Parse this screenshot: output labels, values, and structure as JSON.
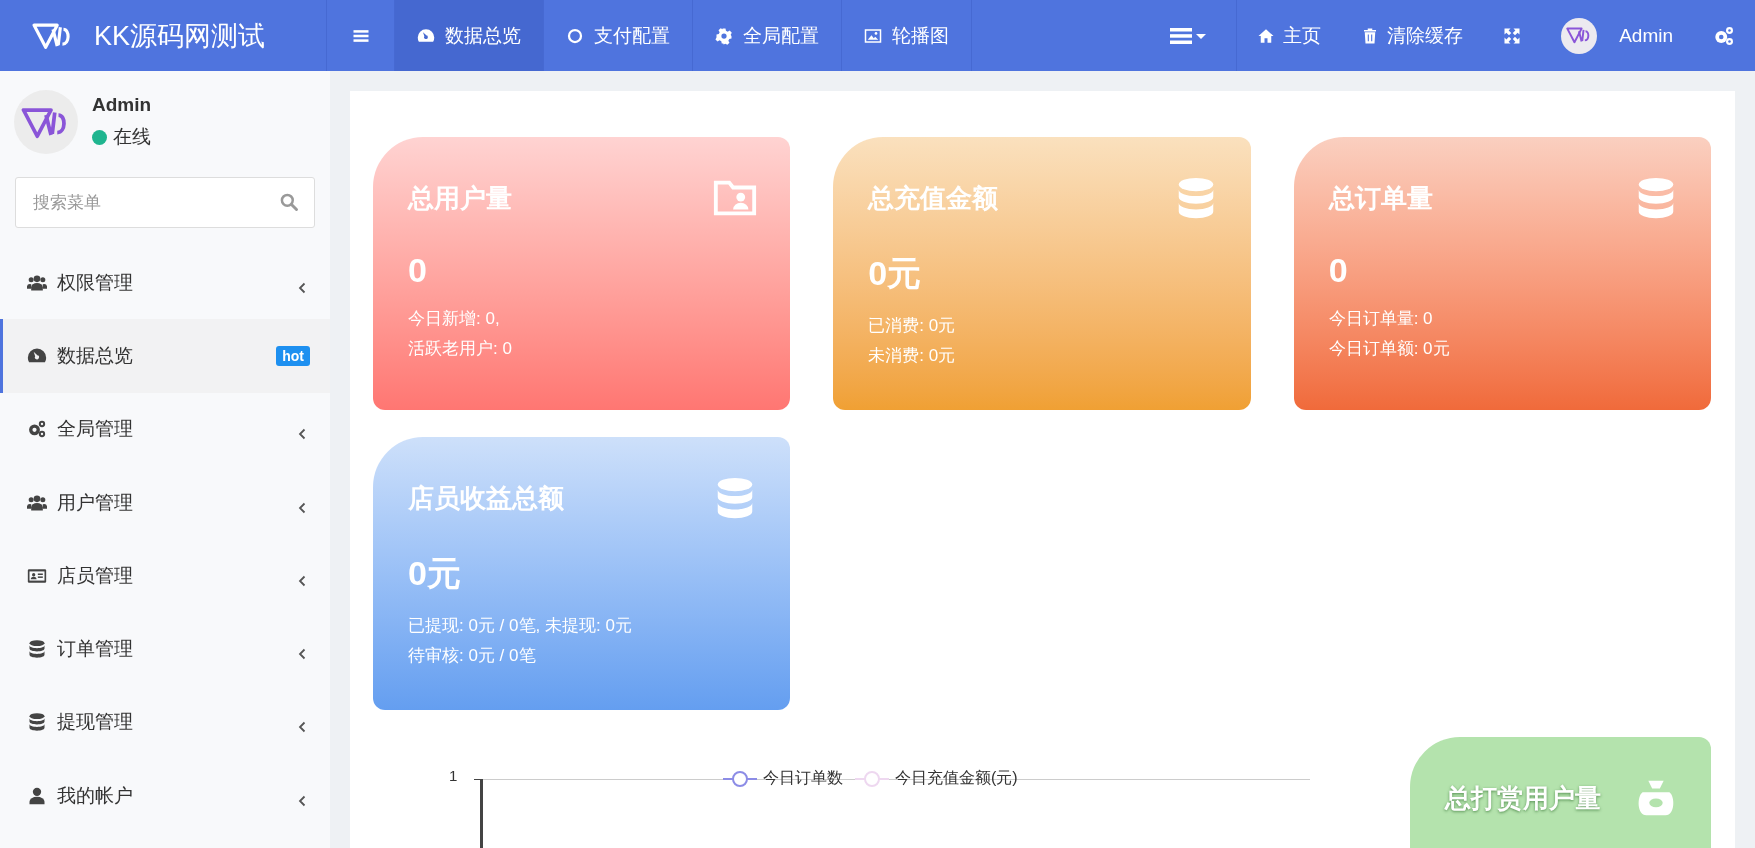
{
  "brand": {
    "title": "KK源码网测试"
  },
  "top_nav": [
    {
      "kind": "dashboard",
      "label": "数据总览",
      "selected": true
    },
    {
      "kind": "circle",
      "label": "支付配置",
      "selected": false
    },
    {
      "kind": "cog",
      "label": "全局配置",
      "selected": false
    },
    {
      "kind": "image",
      "label": "轮播图",
      "selected": false
    }
  ],
  "top_right": [
    {
      "kind": "list-dropdown"
    },
    {
      "kind": "home",
      "label": "主页"
    },
    {
      "kind": "trash",
      "label": "清除缓存"
    },
    {
      "kind": "expand"
    },
    {
      "kind": "avatar",
      "label": "Admin"
    },
    {
      "kind": "cogs"
    }
  ],
  "sidebar": {
    "user": {
      "name": "Admin",
      "status": "在线",
      "online": true
    },
    "search": {
      "placeholder": "搜索菜单"
    },
    "items": [
      {
        "kind": "users",
        "label": "权限管理",
        "selected": false,
        "expandable": true
      },
      {
        "kind": "dashboard",
        "label": "数据总览",
        "selected": true,
        "expandable": false,
        "badge": "hot"
      },
      {
        "kind": "cogs",
        "label": "全局管理",
        "selected": false,
        "expandable": true
      },
      {
        "kind": "users",
        "label": "用户管理",
        "selected": false,
        "expandable": true
      },
      {
        "kind": "idcard",
        "label": "店员管理",
        "selected": false,
        "expandable": true
      },
      {
        "kind": "database",
        "label": "订单管理",
        "selected": false,
        "expandable": true
      },
      {
        "kind": "database",
        "label": "提现管理",
        "selected": false,
        "expandable": true
      },
      {
        "kind": "user",
        "label": "我的帐户",
        "selected": false,
        "expandable": true
      }
    ]
  },
  "cards": [
    {
      "title": "总用户量",
      "kind": "folder-user",
      "value": "0",
      "lines": [
        "今日新增: 0,",
        "活跃老用户: 0"
      ],
      "color": "#ff7672"
    },
    {
      "title": "总充值金额",
      "kind": "database",
      "value": "0元",
      "lines": [
        "已消费: 0元",
        "未消费: 0元"
      ],
      "color": "#f0a033"
    },
    {
      "title": "总订单量",
      "kind": "database",
      "value": "0",
      "lines": [
        "今日订单量: 0",
        "今日订单额: 0元"
      ],
      "color": "#f06a3a"
    },
    {
      "title": "店员收益总额",
      "kind": "database",
      "value": "0元",
      "lines": [
        "已提现: 0元 / 0笔, 未提现: 0元",
        "待审核: 0元 / 0笔"
      ],
      "color": "#649ef0"
    }
  ],
  "chart": {
    "y_tick": "1",
    "legend": [
      {
        "label": "今日订单数",
        "color": "#8c8ce6"
      },
      {
        "label": "今日充值金额(元)",
        "color": "#eed8f0"
      }
    ]
  },
  "side_card": {
    "title": "总打赏用户量",
    "kind": "moneybag",
    "color": "#b4e3ad"
  }
}
